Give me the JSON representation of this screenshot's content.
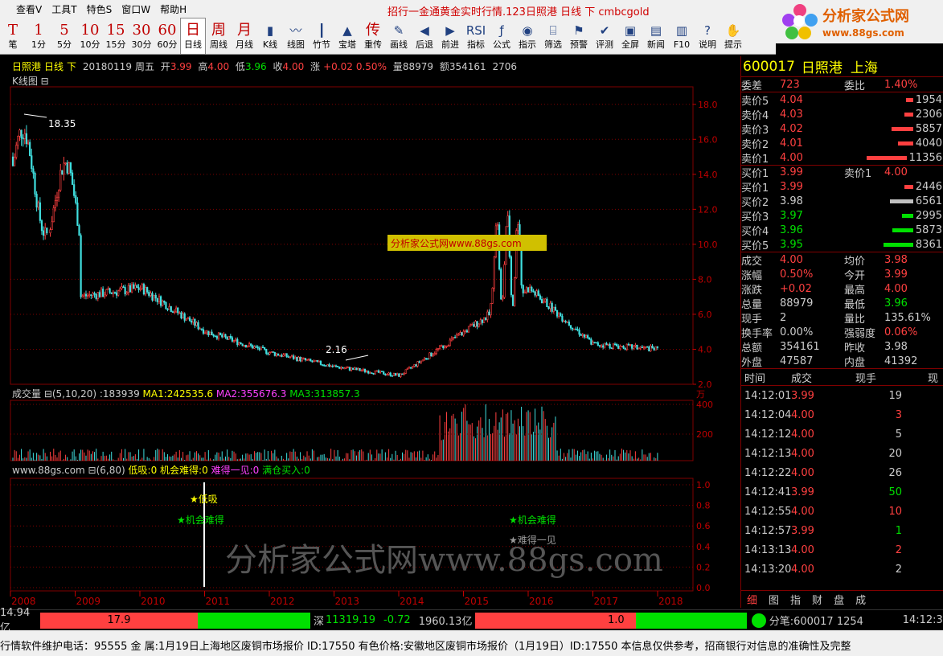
{
  "menu": [
    "查看V",
    "工具T",
    "特色S",
    "窗口W",
    "帮助H"
  ],
  "ticker": "招行一金通黄金实时行情.123日照港 日线 下 cmbcgold",
  "logo": {
    "cn": "分析家公式网",
    "url": "www.88gs.com"
  },
  "toolbar": [
    {
      "big": "T",
      "label": "笔"
    },
    {
      "big": "1",
      "label": "1分"
    },
    {
      "big": "5",
      "label": "5分"
    },
    {
      "big": "10",
      "label": "10分"
    },
    {
      "big": "15",
      "label": "15分"
    },
    {
      "big": "30",
      "label": "30分"
    },
    {
      "big": "60",
      "label": "60分"
    },
    {
      "big": "日",
      "label": "日线",
      "sel": true
    },
    {
      "big": "周",
      "label": "周线"
    },
    {
      "big": "月",
      "label": "月线"
    },
    {
      "icon": "candle-icon",
      "glyph": "▮",
      "label": "K线"
    },
    {
      "icon": "line-chart-icon",
      "glyph": "〰",
      "label": "线图"
    },
    {
      "icon": "bamboo-icon",
      "glyph": "┃",
      "label": "竹节"
    },
    {
      "icon": "tower-icon",
      "glyph": "▲",
      "label": "宝塔"
    },
    {
      "big": "传",
      "label": "重传"
    },
    {
      "icon": "pencil-icon",
      "glyph": "✎",
      "label": "画线"
    },
    {
      "icon": "back-icon",
      "glyph": "◀",
      "label": "后退"
    },
    {
      "icon": "forward-icon",
      "glyph": "▶",
      "label": "前进"
    },
    {
      "icon": "rsi-icon",
      "glyph": "RSI",
      "label": "指标"
    },
    {
      "icon": "formula-icon",
      "glyph": "ƒ",
      "label": "公式"
    },
    {
      "icon": "indicator-icon",
      "glyph": "◉",
      "label": "指示"
    },
    {
      "icon": "filter-icon",
      "glyph": "⌸",
      "label": "筛选"
    },
    {
      "icon": "alarm-icon",
      "glyph": "⚑",
      "label": "预警"
    },
    {
      "icon": "rate-icon",
      "glyph": "✔",
      "label": "评测"
    },
    {
      "icon": "fullscreen-icon",
      "glyph": "▣",
      "label": "全屏"
    },
    {
      "icon": "news-icon",
      "glyph": "▤",
      "label": "新闻"
    },
    {
      "icon": "f10-icon",
      "glyph": "▥",
      "label": "F10"
    },
    {
      "icon": "help-icon",
      "glyph": "?",
      "label": "说明"
    },
    {
      "icon": "hint-icon",
      "glyph": "✋",
      "label": "提示"
    }
  ],
  "info": {
    "name": "日照港",
    "period": "日线",
    "dir": "下",
    "date": "20180119",
    "weekday": "周五",
    "open_l": "开",
    "open": "3.99",
    "high_l": "高",
    "high": "4.00",
    "low_l": "低",
    "low": "3.96",
    "close_l": "收",
    "close": "4.00",
    "chg_l": "涨",
    "chg": "+0.02",
    "pct": "0.50%",
    "vol_l": "量",
    "vol": "88979",
    "amt_l": "额",
    "amt": "354161",
    "num": "2706"
  },
  "kline_label": "K线图 ⊟",
  "watermark": "分析家公式网www.88gs.com",
  "watermark2": "分析家公式网www.88gs.com",
  "price_axis": [
    "18.0",
    "16.0",
    "14.0",
    "12.0",
    "10.0",
    "8.0",
    "6.0",
    "4.0",
    "2.0"
  ],
  "annot": {
    "high": "18.35",
    "low": "2.16"
  },
  "vol_bar": {
    "title": "成交量 ⊟(5,10,20) :183939",
    "ma1": "MA1:242535.6",
    "ma2": "MA2:355676.3",
    "ma3": "MA3:313857.3"
  },
  "vol_axis": {
    "unit": "万",
    "t400": "400",
    "t200": "200"
  },
  "ind_bar": {
    "title": "www.88gs.com ⊟(6,80)",
    "a": "低吸:0",
    "b": "机会难得:0",
    "c": "难得一见:0",
    "d": "满仓买入:0"
  },
  "ind_axis": [
    "1.0",
    "0.8",
    "0.6",
    "0.4",
    "0.2",
    "0.0"
  ],
  "ind_marks": {
    "m1": "★低吸",
    "m2": "★机会难得",
    "m3": "★机会难得",
    "m4": "★难得一见"
  },
  "years": [
    "2008",
    "2009",
    "2010",
    "2011",
    "2012",
    "2013",
    "2014",
    "2015",
    "2016",
    "2017",
    "2018"
  ],
  "chart_data": {
    "type": "candlestick",
    "title": "日照港 日线",
    "ylim": [
      2,
      19
    ],
    "high": 18.35,
    "low": 2.16,
    "years": [
      "2008",
      "2009",
      "2010",
      "2011",
      "2012",
      "2013",
      "2014",
      "2015",
      "2016",
      "2017",
      "2018"
    ],
    "approx_close_by_period": [
      15.0,
      7.0,
      7.5,
      5.0,
      3.8,
      3.0,
      2.5,
      5.0,
      7.5,
      4.3,
      4.0
    ]
  },
  "quote": {
    "code": "600017",
    "name": "日照港",
    "market": "上海",
    "wc_l": "委差",
    "wc": "723",
    "wb_l": "委比",
    "wb": "1.40%",
    "asks": [
      {
        "l": "卖价5",
        "p": "4.04",
        "q": "1954",
        "w": 20
      },
      {
        "l": "卖价4",
        "p": "4.03",
        "q": "2306",
        "w": 24
      },
      {
        "l": "卖价3",
        "p": "4.02",
        "q": "5857",
        "w": 60
      },
      {
        "l": "卖价2",
        "p": "4.01",
        "q": "4040",
        "w": 42
      },
      {
        "l": "卖价1",
        "p": "4.00",
        "q": "11356",
        "w": 110
      }
    ],
    "bid_mid": {
      "l": "买价1",
      "p": "3.99",
      "l2": "卖价1",
      "p2": "4.00"
    },
    "bids": [
      {
        "l": "买价1",
        "p": "3.99",
        "q": "2446",
        "w": 25,
        "c": "r"
      },
      {
        "l": "买价2",
        "p": "3.98",
        "q": "6561",
        "w": 64,
        "c": "w"
      },
      {
        "l": "买价3",
        "p": "3.97",
        "q": "2995",
        "w": 30,
        "c": "g"
      },
      {
        "l": "买价4",
        "p": "3.96",
        "q": "5873",
        "w": 58,
        "c": "g"
      },
      {
        "l": "买价5",
        "p": "3.95",
        "q": "8361",
        "w": 82,
        "c": "g"
      }
    ],
    "stats": [
      {
        "a": "成交",
        "b": "4.00",
        "bc": "r",
        "c": "均价",
        "d": "3.98",
        "dc": "r"
      },
      {
        "a": "涨幅",
        "b": "0.50%",
        "bc": "r",
        "c": "今开",
        "d": "3.99",
        "dc": "r"
      },
      {
        "a": "涨跌",
        "b": "+0.02",
        "bc": "r",
        "c": "最高",
        "d": "4.00",
        "dc": "r"
      },
      {
        "a": "总量",
        "b": "88979",
        "bc": "w",
        "c": "最低",
        "d": "3.96",
        "dc": "g"
      },
      {
        "a": "现手",
        "b": "2",
        "bc": "w",
        "c": "量比",
        "d": "135.61%",
        "dc": "w"
      },
      {
        "a": "换手率",
        "b": "0.00%",
        "bc": "w",
        "c": "强弱度",
        "d": "0.06%",
        "dc": "r"
      },
      {
        "a": "总额",
        "b": "354161",
        "bc": "w",
        "c": "昨收",
        "d": "3.98",
        "dc": "w"
      },
      {
        "a": "外盘",
        "b": "47587",
        "bc": "w",
        "c": "内盘",
        "d": "41392",
        "dc": "w"
      }
    ]
  },
  "ticks_head": {
    "t": "时间",
    "p": "成交",
    "v": "现手",
    "x": "现"
  },
  "ticks": [
    {
      "t": "14:12:01",
      "p": "3.99",
      "pc": "r",
      "v": "19",
      "vc": "w"
    },
    {
      "t": "14:12:04",
      "p": "4.00",
      "pc": "r",
      "v": "3",
      "vc": "r"
    },
    {
      "t": "14:12:12",
      "p": "4.00",
      "pc": "r",
      "v": "5",
      "vc": "w"
    },
    {
      "t": "14:12:13",
      "p": "4.00",
      "pc": "r",
      "v": "20",
      "vc": "w"
    },
    {
      "t": "14:12:22",
      "p": "4.00",
      "pc": "r",
      "v": "26",
      "vc": "w"
    },
    {
      "t": "14:12:41",
      "p": "3.99",
      "pc": "r",
      "v": "50",
      "vc": "g"
    },
    {
      "t": "14:12:55",
      "p": "4.00",
      "pc": "r",
      "v": "10",
      "vc": "r"
    },
    {
      "t": "14:12:57",
      "p": "3.99",
      "pc": "r",
      "v": "1",
      "vc": "g"
    },
    {
      "t": "14:13:13",
      "p": "4.00",
      "pc": "r",
      "v": "2",
      "vc": "r"
    },
    {
      "t": "14:13:20",
      "p": "4.00",
      "pc": "r",
      "v": "2",
      "vc": "w"
    }
  ],
  "rtabs": [
    "细",
    "图",
    "指",
    "财",
    "盘",
    "成"
  ],
  "status": {
    "amt1": "14.94亿",
    "bar1": "17.9",
    "sz_l": "深",
    "sz": "11319.19",
    "sz_chg": "-0.72",
    "amt2": "1960.13亿",
    "bar2": "1.0",
    "note": "分笔:600017 1254",
    "time": "14:12:3"
  },
  "bottom": "行情软件维护电话：95555   金   属:1月19日上海地区废铜市场报价 ID:17550    有色价格:安徽地区废铜市场报价（1月19日）ID:17550    本信息仅供参考，招商银行对信息的准确性及完整"
}
